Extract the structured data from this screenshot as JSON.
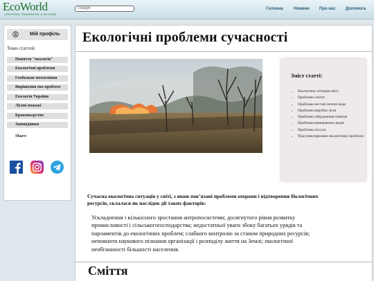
{
  "header": {
    "logo_text": "EcoWorld",
    "logo_subtitle": "CREATING TOMORROW & BEYOND",
    "search_placeholder": "Пошук",
    "nav": [
      "Головна",
      "Новини",
      "Про нас",
      "Допомога"
    ]
  },
  "sidebar": {
    "profile_label": "Мій профіль",
    "topics_title": "Теми статтей:",
    "topics": [
      "Поняття \"екологія\"",
      "Екологічні проблеми",
      "Глобальне потепління",
      "Вирішення еко проблем",
      "Екологія України",
      "Лісові пожежі",
      "Браконьєрство",
      "Заповідники"
    ],
    "share_label": "Share:",
    "social_icons": [
      "facebook-icon",
      "instagram-icon",
      "telegram-icon"
    ]
  },
  "main": {
    "title": "Екологічні проблеми сучасності",
    "toc_title": "Зміст статті:",
    "toc_items": [
      "Екологічна ситуація світу",
      "Проблема сміття",
      "Проблема нестачі питної води",
      "Проблема вирубки лісів",
      "Проблема забруднення повітря",
      "Проблема вимирaючих видів",
      "Проблема посухи",
      "Підсумок(причини екологічних проблем)"
    ],
    "lead_text": "Сучасна екологічна ситуація у світі, з якою пов’язані проблеми охорони і відтворення біологічних ресурсів, склалася як наслідок дії таких факторів:",
    "body_text": "Ускладнення і кількісного зростання антропосистеми; досягнутого рівня розвитку промисловості і сільськогогосподарства; недостатньої уваги збоку багатьох урядів та парламентів до екологічних проблем; слабкого контролю за станом природних ресурсів; неповноти наукового пізнання організації і розподілу життя на Землі; екологічної необізнаності більшості населення.",
    "section2_title": "Сміття"
  }
}
